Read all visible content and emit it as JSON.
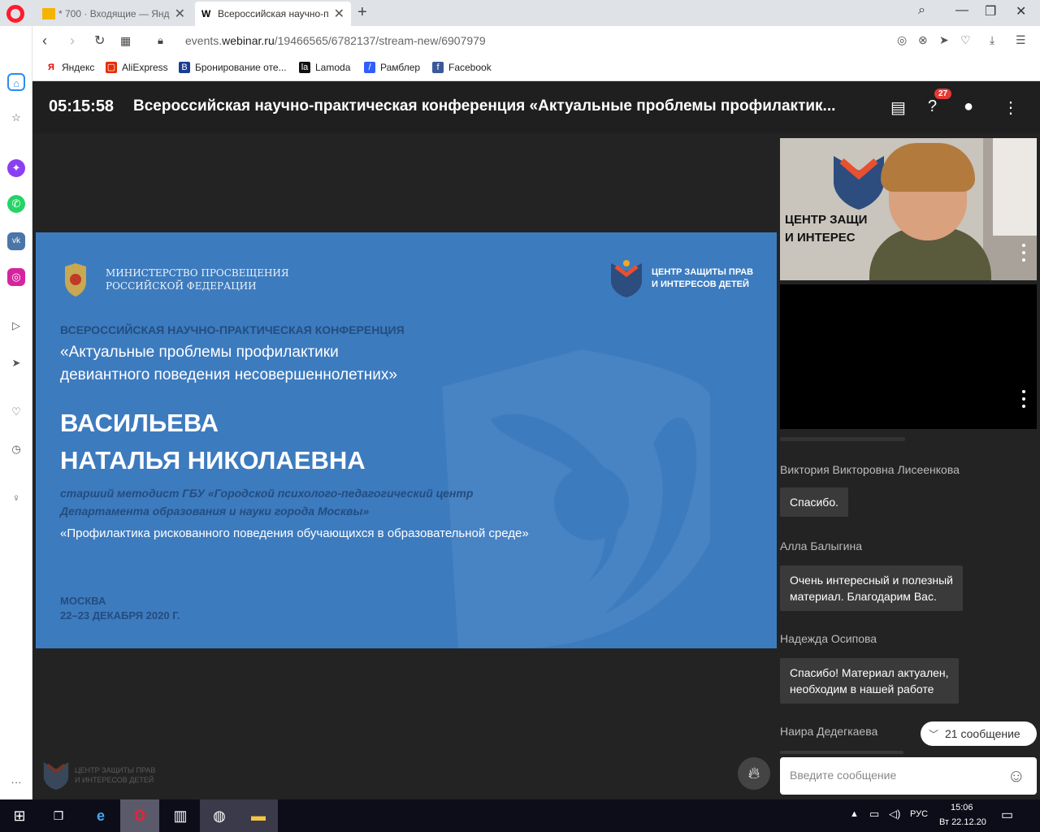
{
  "tabs": [
    {
      "title": "* 700 · Входящие — Яндекс",
      "close": "✕"
    },
    {
      "title": "Всероссийская научно-пр",
      "close": "✕"
    }
  ],
  "newtab": "+",
  "address": {
    "prefix": "events.",
    "domain": "webinar.ru",
    "path": "/19466565/6782137/stream-new/6907979"
  },
  "bookmarks": [
    "Яндекс",
    "AliExpress",
    "Бронирование оте...",
    "Lamoda",
    "Рамблер",
    "Facebook"
  ],
  "header": {
    "timer": "05:15:58",
    "title": "Всероссийская научно-практическая конференция «Актуальные проблемы профилактик...",
    "questions_badge": "27"
  },
  "slide": {
    "ministry": "МИНИСТЕРСТВО ПРОСВЕЩЕНИЯ\nРОССИЙСКОЙ ФЕДЕРАЦИИ",
    "center": "ЦЕНТР ЗАЩИТЫ ПРАВ\nИ ИНТЕРЕСОВ ДЕТЕЙ",
    "conf_label": "ВСЕРОССИЙСКАЯ НАУЧНО-ПРАКТИЧЕСКАЯ КОНФЕРЕНЦИЯ",
    "conf_name": "«Актуальные проблемы профилактики\nдевиантного поведения несовершеннолетних»",
    "speaker": "ВАСИЛЬЕВА\nНАТАЛЬЯ НИКОЛАЕВНА",
    "position": "старший методист ГБУ «Городской психолого-педагогический центр\nДепартамента образования и науки города Москвы»",
    "talk": "«Профилактика рискованного поведения обучающихся в образовательной среде»",
    "city": "МОСКВА",
    "dates": "22–23 ДЕКАБРЯ 2020 Г."
  },
  "camera": {
    "sign": "ЦЕНТР ЗАЩИ\nИ ИНТЕРЕС"
  },
  "chat": [
    {
      "author": "Виктория Викторовна Лисеенкова",
      "text": "Спасибо."
    },
    {
      "author": "Алла Балыгина",
      "text": "Очень интересный и полезный\nматериал. Благодарим Вас."
    },
    {
      "author": "Надежда Осипова",
      "text": "Спасибо! Материал актуален,\nнеобходим в нашей работе"
    },
    {
      "author": "Наира Дедегкаева",
      "text": ""
    }
  ],
  "new_messages": "21 сообщение",
  "input_placeholder": "Введите сообщение",
  "watermark": "ЦЕНТР ЗАЩИТЫ ПРАВ\nИ ИНТЕРЕСОВ ДЕТЕЙ",
  "tray": {
    "lang": "РУС",
    "time": "15:06",
    "date": "Вт 22.12.20"
  }
}
